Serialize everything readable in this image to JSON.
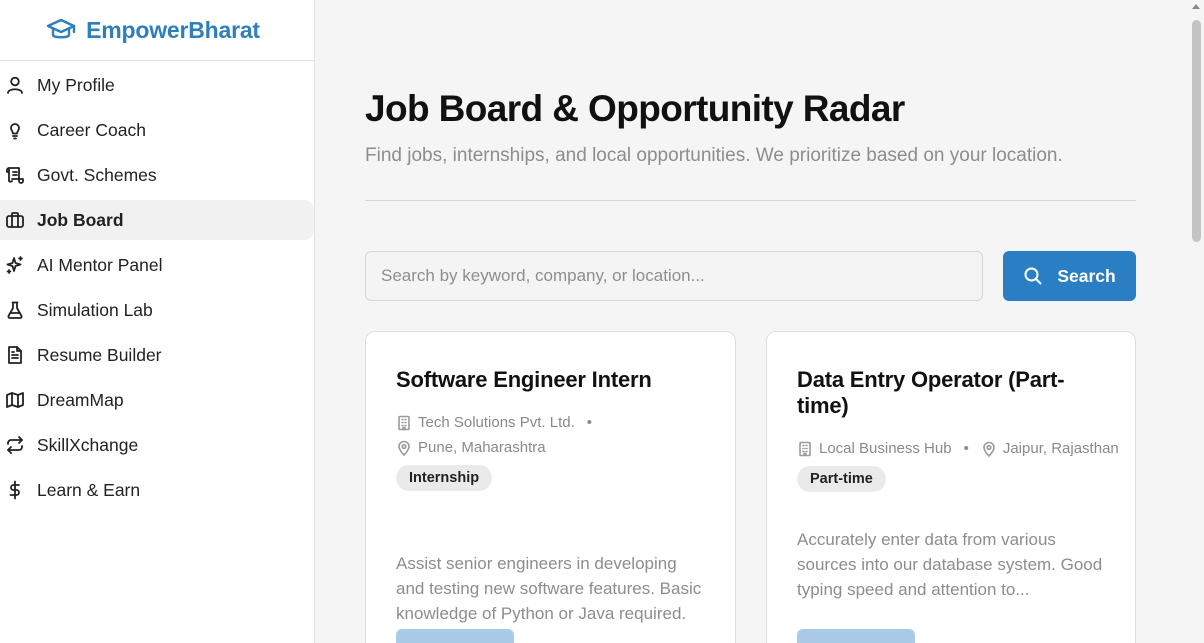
{
  "brand": {
    "name": "EmpowerBharat",
    "icon": "graduation-cap-icon"
  },
  "sidebar": {
    "items": [
      {
        "label": "My Profile",
        "icon": "user-icon",
        "active": false
      },
      {
        "label": "Career Coach",
        "icon": "lightbulb-icon",
        "active": false
      },
      {
        "label": "Govt. Schemes",
        "icon": "scroll-icon",
        "active": false
      },
      {
        "label": "Job Board",
        "icon": "briefcase-icon",
        "active": true
      },
      {
        "label": "AI Mentor Panel",
        "icon": "sparkles-icon",
        "active": false
      },
      {
        "label": "Simulation Lab",
        "icon": "flask-icon",
        "active": false
      },
      {
        "label": "Resume Builder",
        "icon": "document-icon",
        "active": false
      },
      {
        "label": "DreamMap",
        "icon": "map-icon",
        "active": false
      },
      {
        "label": "SkillXchange",
        "icon": "exchange-icon",
        "active": false
      },
      {
        "label": "Learn & Earn",
        "icon": "dollar-icon",
        "active": false
      }
    ]
  },
  "main": {
    "title": "Job Board & Opportunity Radar",
    "subtitle": "Find jobs, internships, and local opportunities. We prioritize based on your location.",
    "search": {
      "placeholder": "Search by keyword, company, or location...",
      "value": "",
      "button_label": "Search"
    },
    "jobs": [
      {
        "title": "Software Engineer Intern",
        "company": "Tech Solutions Pvt. Ltd.",
        "location": "Pune, Maharashtra",
        "type": "Internship",
        "description": "Assist senior engineers in developing and testing new software features. Basic knowledge of Python or Java required."
      },
      {
        "title": "Data Entry Operator (Part-time)",
        "company": "Local Business Hub",
        "location": "Jaipur, Rajasthan",
        "type": "Part-time",
        "description": "Accurately enter data from various sources into our database system. Good typing speed and attention to..."
      }
    ]
  },
  "colors": {
    "accent": "#2a7ec3",
    "brand": "#2f7fbd",
    "apply_button": "#a9cbe8"
  }
}
